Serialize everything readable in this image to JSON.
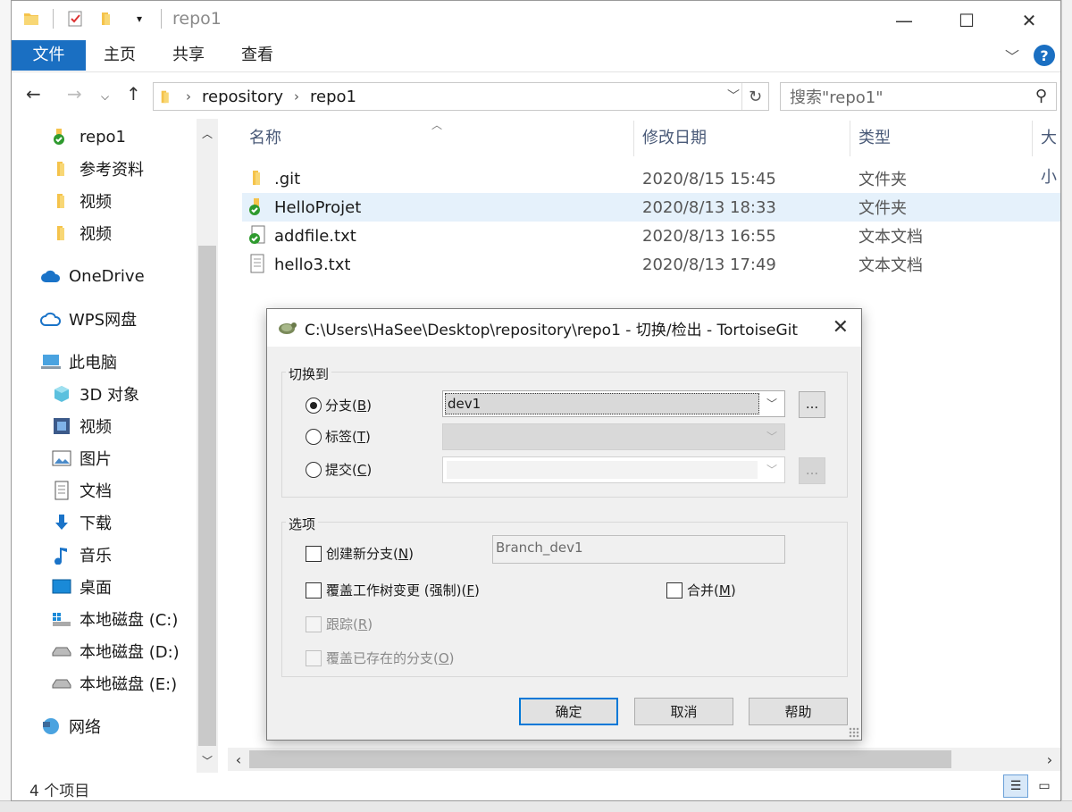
{
  "window": {
    "title": "repo1",
    "controls": {
      "minimize": "—",
      "maximize": "☐",
      "close": "✕"
    }
  },
  "ribbon": {
    "tabs": [
      "文件",
      "主页",
      "共享",
      "查看"
    ],
    "help": "?"
  },
  "address": {
    "crumbs": [
      "repository",
      "repo1"
    ],
    "search_placeholder": "搜索\"repo1\""
  },
  "sidebar": {
    "items": [
      {
        "label": "repo1",
        "icon": "git-folder-icon"
      },
      {
        "label": "参考资料",
        "icon": "folder-icon"
      },
      {
        "label": "视频",
        "icon": "folder-icon"
      },
      {
        "label": "视频",
        "icon": "folder-icon"
      },
      {
        "label": "OneDrive",
        "icon": "onedrive-icon"
      },
      {
        "label": "WPS网盘",
        "icon": "wps-cloud-icon"
      },
      {
        "label": "此电脑",
        "icon": "computer-icon"
      },
      {
        "label": "3D 对象",
        "icon": "3d-objects-icon"
      },
      {
        "label": "视频",
        "icon": "video-icon"
      },
      {
        "label": "图片",
        "icon": "pictures-icon"
      },
      {
        "label": "文档",
        "icon": "documents-icon"
      },
      {
        "label": "下载",
        "icon": "download-icon"
      },
      {
        "label": "音乐",
        "icon": "music-icon"
      },
      {
        "label": "桌面",
        "icon": "desktop-icon"
      },
      {
        "label": "本地磁盘 (C:)",
        "icon": "drive-c-icon"
      },
      {
        "label": "本地磁盘 (D:)",
        "icon": "drive-icon"
      },
      {
        "label": "本地磁盘 (E:)",
        "icon": "drive-icon"
      },
      {
        "label": "网络",
        "icon": "network-icon"
      }
    ]
  },
  "columns": [
    "名称",
    "修改日期",
    "类型",
    "大小"
  ],
  "files": [
    {
      "name": ".git",
      "date": "2020/8/15 15:45",
      "type": "文件夹",
      "icon": "folder-icon"
    },
    {
      "name": "HelloProjet",
      "date": "2020/8/13 18:33",
      "type": "文件夹",
      "icon": "git-folder-icon"
    },
    {
      "name": "addfile.txt",
      "date": "2020/8/13 16:55",
      "type": "文本文档",
      "icon": "git-file-icon"
    },
    {
      "name": "hello3.txt",
      "date": "2020/8/13 17:49",
      "type": "文本文档",
      "icon": "text-file-icon"
    }
  ],
  "status": {
    "item_count": "4 个项目"
  },
  "dialog": {
    "title": "C:\\Users\\HaSee\\Desktop\\repository\\repo1 - 切换/检出 - TortoiseGit",
    "switch_to": {
      "label": "切换到",
      "branch": {
        "text": "分支(",
        "key": "B",
        "end": ")"
      },
      "tag": {
        "text": "标签(",
        "key": "T",
        "end": ")"
      },
      "commit": {
        "text": "提交(",
        "key": "C",
        "end": ")"
      },
      "branch_value": "dev1",
      "browse": "..."
    },
    "options": {
      "label": "选项",
      "create_branch": {
        "text": "创建新分支(",
        "key": "N",
        "end": ")"
      },
      "new_branch_name": "Branch_dev1",
      "override_worktree": {
        "text": "覆盖工作树变更 (强制)(",
        "key": "F",
        "end": ")"
      },
      "merge": {
        "text": "合并(",
        "key": "M",
        "end": ")"
      },
      "track": {
        "text": "跟踪(",
        "key": "R",
        "end": ")"
      },
      "override_branch": {
        "text": "覆盖已存在的分支(",
        "key": "O",
        "end": ")"
      }
    },
    "buttons": {
      "ok": "确定",
      "cancel": "取消",
      "help": "帮助"
    },
    "close": "✕"
  }
}
